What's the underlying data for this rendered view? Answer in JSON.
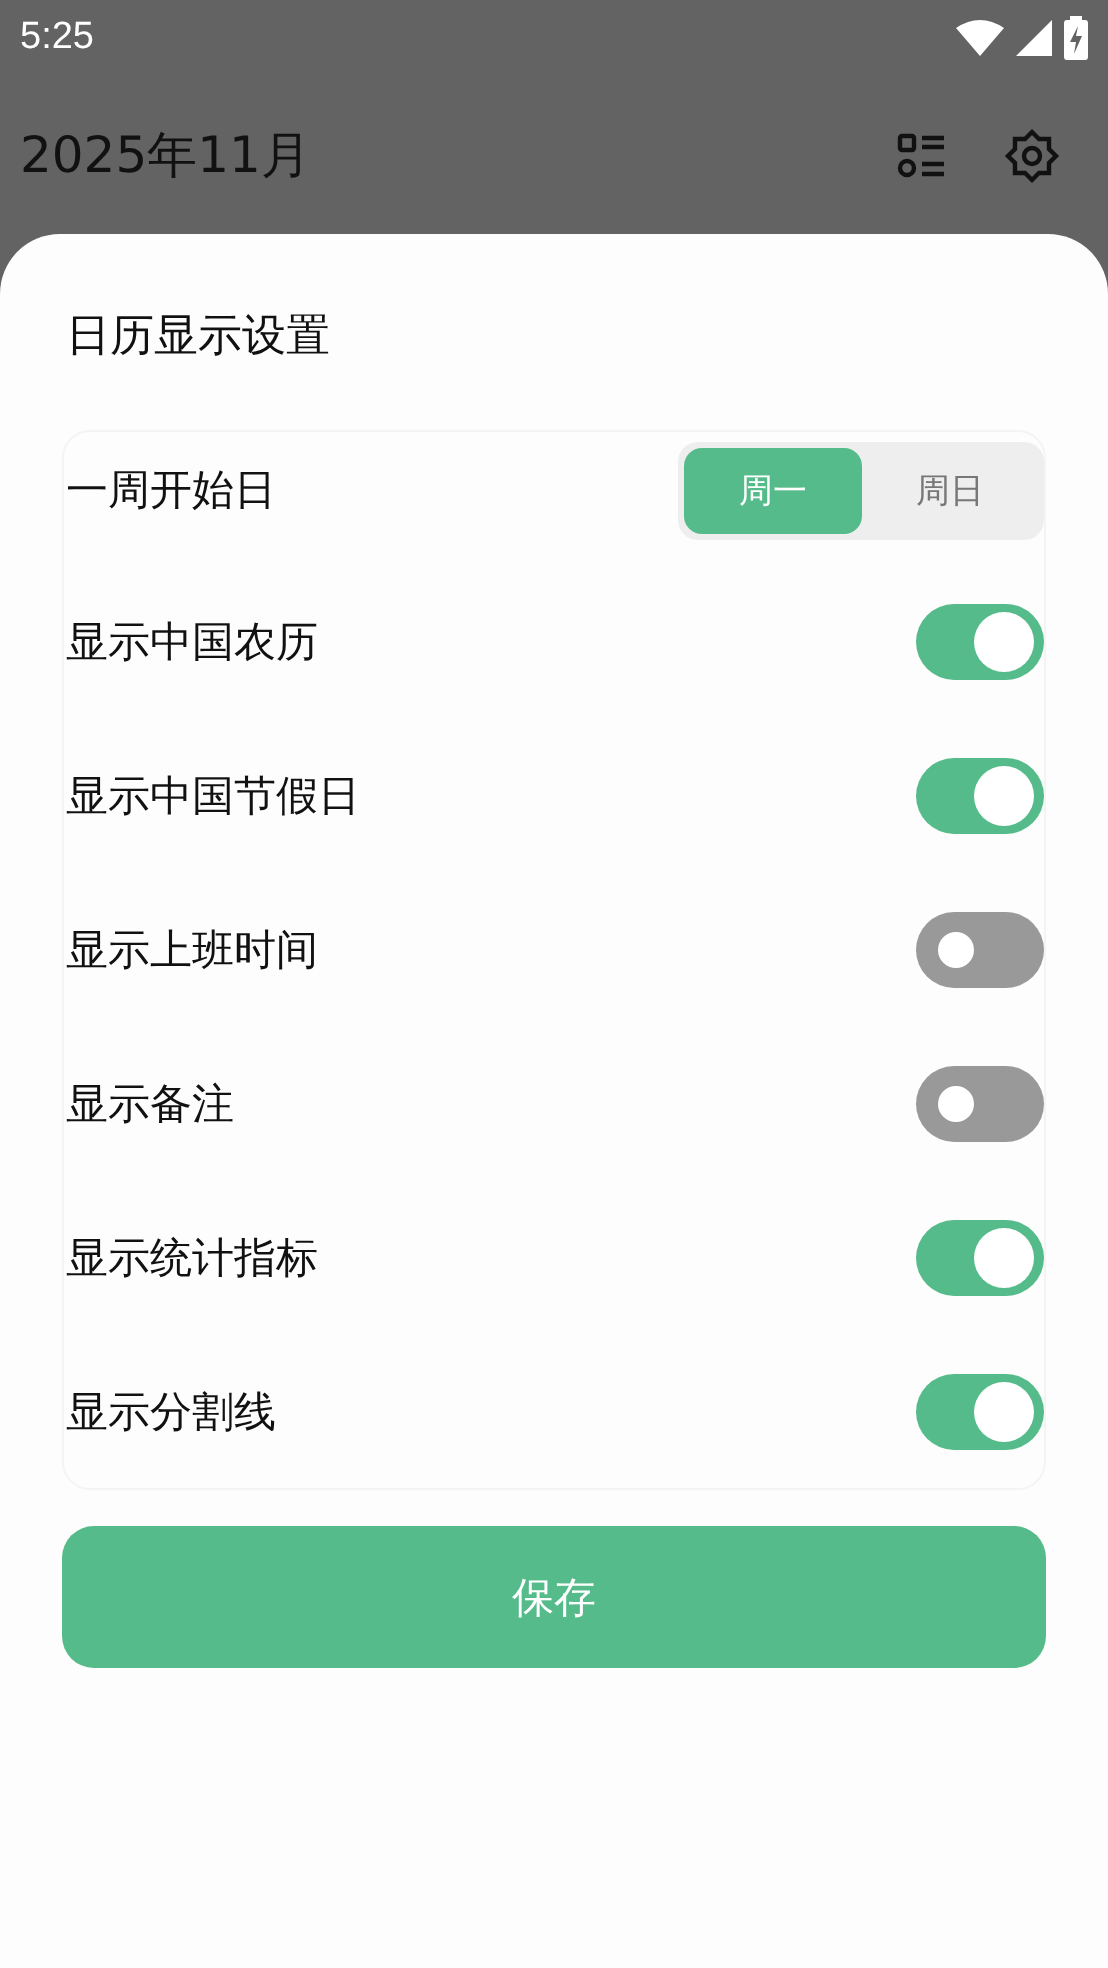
{
  "status_bar": {
    "time": "5:25"
  },
  "app_bar": {
    "title": "2025年11月"
  },
  "sheet": {
    "title": "日历显示设置",
    "settings": [
      {
        "kind": "segment",
        "label": "一周开始日",
        "options": [
          {
            "label": "周一",
            "selected": true
          },
          {
            "label": "周日",
            "selected": false
          }
        ]
      },
      {
        "kind": "toggle",
        "label": "显示中国农历",
        "on": true
      },
      {
        "kind": "toggle",
        "label": "显示中国节假日",
        "on": true
      },
      {
        "kind": "toggle",
        "label": "显示上班时间",
        "on": false
      },
      {
        "kind": "toggle",
        "label": "显示备注",
        "on": false
      },
      {
        "kind": "toggle",
        "label": "显示统计指标",
        "on": true
      },
      {
        "kind": "toggle",
        "label": "显示分割线",
        "on": true
      }
    ],
    "save_button": "保存"
  }
}
